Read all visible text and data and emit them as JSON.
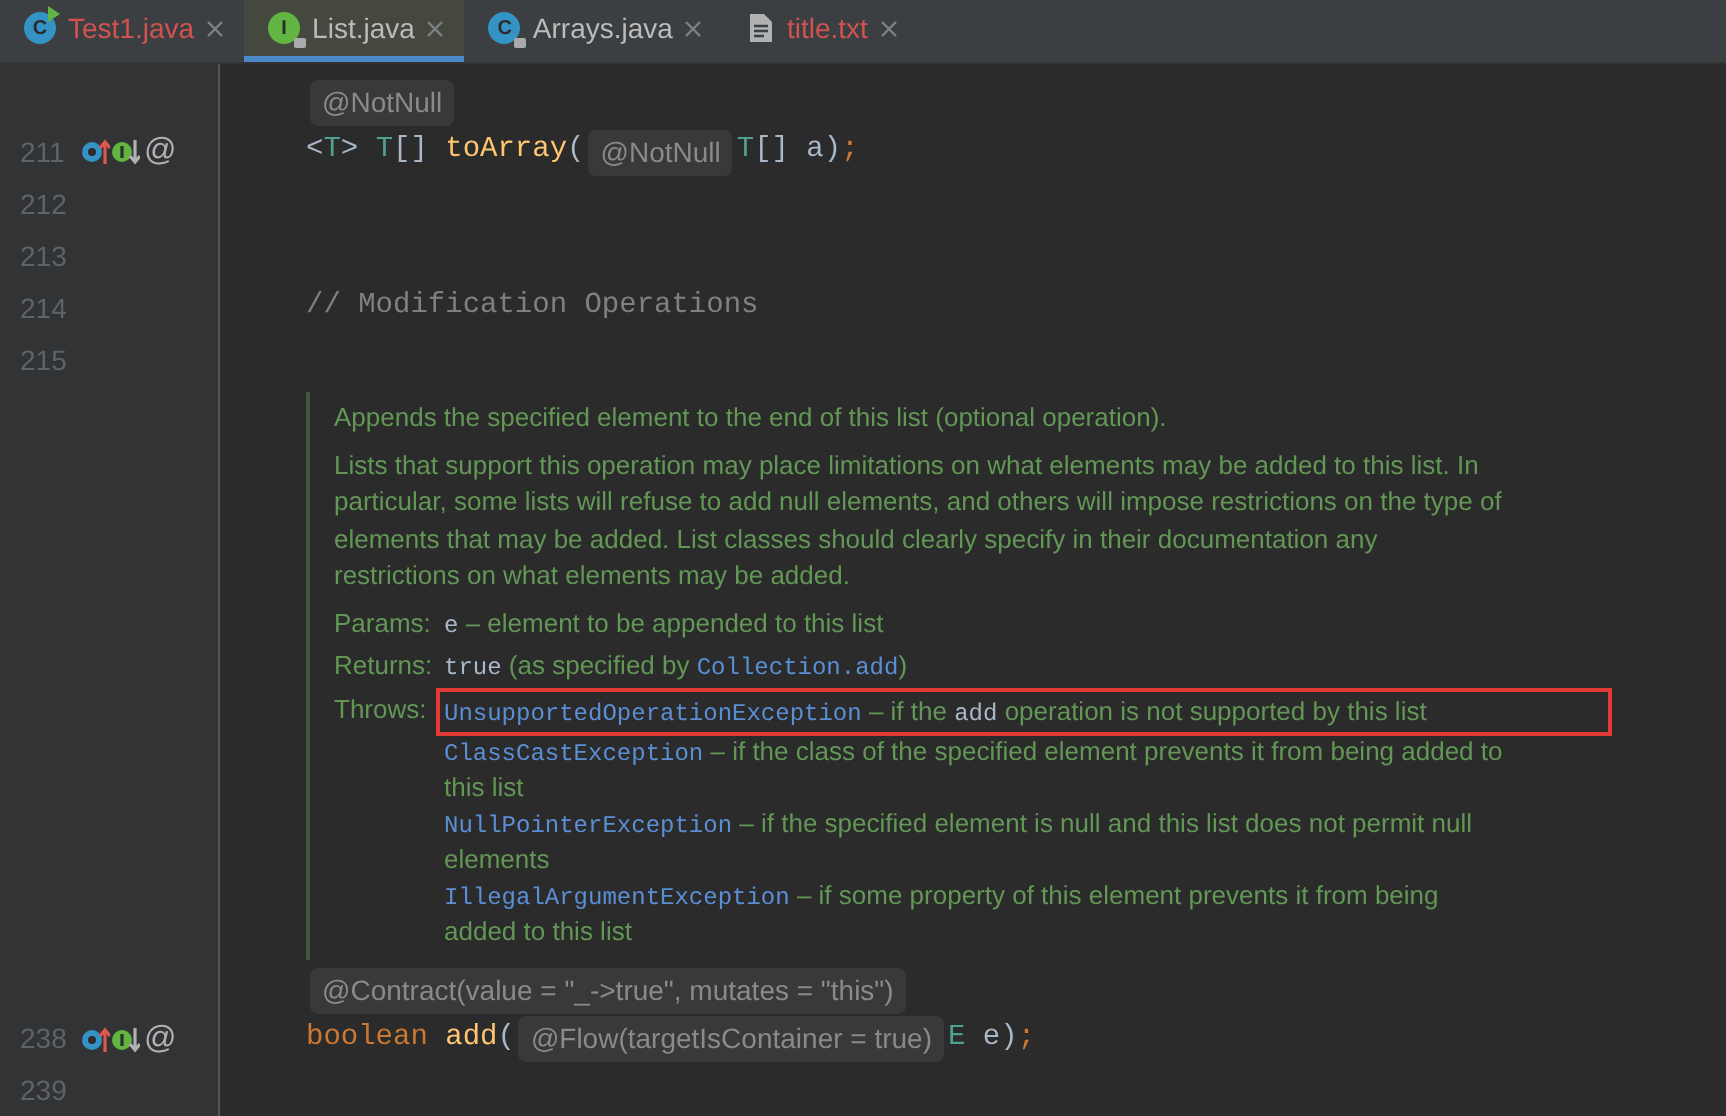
{
  "tabs": [
    {
      "label": "Test1.java",
      "kind": "class",
      "icon_letter": "C",
      "runnable": true,
      "locked": false,
      "color": "#d25252",
      "selected": false
    },
    {
      "label": "List.java",
      "kind": "interface",
      "icon_letter": "I",
      "runnable": false,
      "locked": true,
      "color": "#bbbbbb",
      "selected": true
    },
    {
      "label": "Arrays.java",
      "kind": "class",
      "icon_letter": "C",
      "runnable": false,
      "locked": true,
      "color": "#bbbbbb",
      "selected": false
    },
    {
      "label": "title.txt",
      "kind": "text",
      "runnable": false,
      "locked": false,
      "color": "#d25252",
      "selected": false
    }
  ],
  "editor_lines": [
    {
      "kind": "inlay",
      "tokens": [
        {
          "text": "@NotNull",
          "kind": "inlay"
        }
      ]
    },
    {
      "kind": "code",
      "number": "211",
      "markers": {
        "overrides": true,
        "implemented": true,
        "annotation": "@"
      },
      "tokens": [
        {
          "text": "<",
          "kind": "punct"
        },
        {
          "text": "T",
          "kind": "type"
        },
        {
          "text": "> ",
          "kind": "punct"
        },
        {
          "text": "T",
          "kind": "type"
        },
        {
          "text": "[] ",
          "kind": "punct"
        },
        {
          "text": "toArray",
          "kind": "method"
        },
        {
          "text": "(",
          "kind": "punct"
        },
        {
          "text": "@NotNull",
          "kind": "inlay"
        },
        {
          "text": "T",
          "kind": "type"
        },
        {
          "text": "[] a)",
          "kind": "punct"
        },
        {
          "text": ";",
          "kind": "keyword"
        }
      ]
    },
    {
      "kind": "code",
      "number": "212"
    },
    {
      "kind": "code",
      "number": "213"
    },
    {
      "kind": "code",
      "number": "214",
      "tokens": [
        {
          "text": "// Modification Operations",
          "kind": "comment"
        }
      ]
    },
    {
      "kind": "code",
      "number": "215"
    },
    {
      "kind": "doc",
      "paragraphs": [
        [
          {
            "text": "Appends the specified element to the end of this list (optional operation).",
            "kind": "text"
          }
        ],
        [
          {
            "text": "Lists that support this operation may place limitations on what elements may be added to this list. In particular, some lists will refuse to add null elements, and others will impose restrictions on the type of elements that may be added. List classes should clearly specify in their documentation any restrictions on what elements may be added.",
            "kind": "text"
          }
        ]
      ],
      "sections": [
        {
          "label": "Params:",
          "items": [
            {
              "highlighted": false,
              "tokens": [
                {
                  "text": "e",
                  "kind": "code"
                },
                {
                  "text": " – element to be appended to this list",
                  "kind": "text"
                }
              ]
            }
          ]
        },
        {
          "label": "Returns:",
          "items": [
            {
              "highlighted": false,
              "tokens": [
                {
                  "text": "true",
                  "kind": "code"
                },
                {
                  "text": " (as specified by ",
                  "kind": "text"
                },
                {
                  "text": "Collection.add",
                  "kind": "link"
                },
                {
                  "text": ")",
                  "kind": "text"
                }
              ]
            }
          ]
        },
        {
          "label": "Throws:",
          "items": [
            {
              "highlighted": true,
              "tokens": [
                {
                  "text": "UnsupportedOperationException",
                  "kind": "link"
                },
                {
                  "text": " – if the ",
                  "kind": "text"
                },
                {
                  "text": "add",
                  "kind": "code"
                },
                {
                  "text": " operation is not supported by this list",
                  "kind": "text"
                }
              ]
            },
            {
              "highlighted": false,
              "tokens": [
                {
                  "text": "ClassCastException",
                  "kind": "link"
                },
                {
                  "text": " – if the class of the specified element prevents it from being added to this list",
                  "kind": "text"
                }
              ]
            },
            {
              "highlighted": false,
              "tokens": [
                {
                  "text": "NullPointerException",
                  "kind": "link"
                },
                {
                  "text": " – if the specified element is null and this list does not permit null elements",
                  "kind": "text"
                }
              ]
            },
            {
              "highlighted": false,
              "tokens": [
                {
                  "text": "IllegalArgumentException",
                  "kind": "link"
                },
                {
                  "text": " – if some property of this element prevents it from being added to this list",
                  "kind": "text"
                }
              ]
            }
          ]
        }
      ]
    },
    {
      "kind": "inlay",
      "tokens": [
        {
          "text": "@Contract(value = \"_->true\", mutates = \"this\")",
          "kind": "inlay"
        }
      ]
    },
    {
      "kind": "code",
      "number": "238",
      "markers": {
        "overrides": true,
        "implemented": true,
        "annotation": "@"
      },
      "tokens": [
        {
          "text": "boolean ",
          "kind": "keyword"
        },
        {
          "text": "add",
          "kind": "method"
        },
        {
          "text": "(",
          "kind": "punct"
        },
        {
          "text": "@Flow(targetIsContainer = true)",
          "kind": "inlay"
        },
        {
          "text": "E ",
          "kind": "type"
        },
        {
          "text": "e)",
          "kind": "punct"
        },
        {
          "text": ";",
          "kind": "keyword"
        }
      ]
    },
    {
      "kind": "code",
      "number": "239"
    }
  ]
}
